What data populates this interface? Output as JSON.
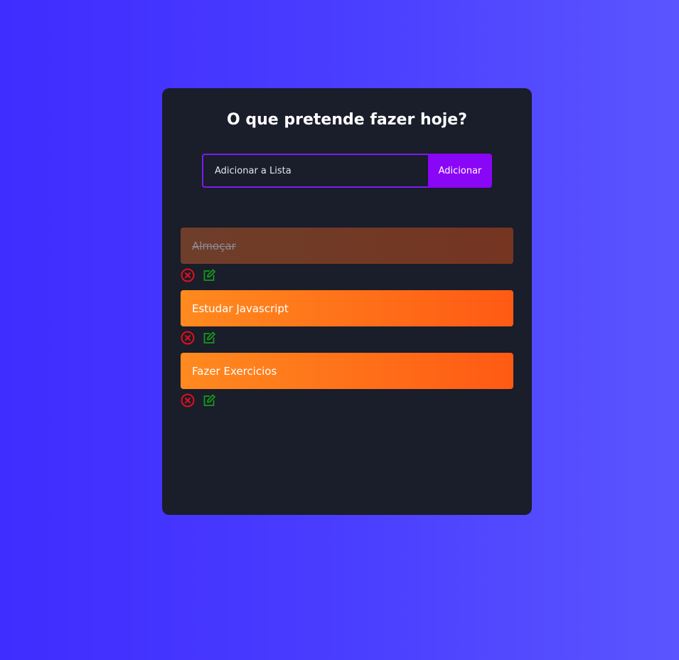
{
  "header": {
    "title": "O que pretende fazer hoje?"
  },
  "form": {
    "placeholder": "Adicionar a Lista",
    "button_label": "Adicionar"
  },
  "todos": [
    {
      "text": "Almoçar",
      "completed": true
    },
    {
      "text": "Estudar Javascript",
      "completed": false
    },
    {
      "text": "Fazer Exercicios",
      "completed": false
    }
  ],
  "icons": {
    "delete": "close-circle-icon",
    "edit": "edit-icon"
  },
  "colors": {
    "background": "#4a3dff",
    "card": "#1a1d2a",
    "accent": "#8a06f7",
    "todo_start": "#ff8a1f",
    "todo_end": "#ff5a14",
    "delete_icon": "#e0101a",
    "edit_icon": "#159a1c"
  }
}
